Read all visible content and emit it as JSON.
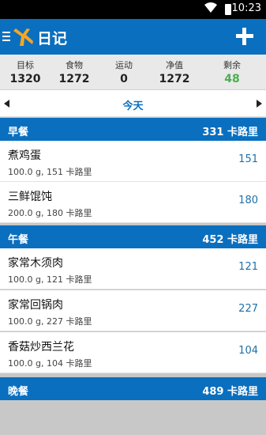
{
  "status": {
    "time": "10:23"
  },
  "header": {
    "title": "日记"
  },
  "summary": [
    {
      "label": "目标",
      "value": "1320"
    },
    {
      "label": "食物",
      "value": "1272"
    },
    {
      "label": "运动",
      "value": "0"
    },
    {
      "label": "净值",
      "value": "1272"
    },
    {
      "label": "剩余",
      "value": "48"
    }
  ],
  "date": {
    "label": "今天"
  },
  "meals": {
    "breakfast": {
      "name": "早餐",
      "calories": "331 卡路里"
    },
    "lunch": {
      "name": "午餐",
      "calories": "452 卡路里"
    },
    "dinner": {
      "name": "晚餐",
      "calories": "489 卡路里"
    }
  },
  "foods": [
    {
      "name": "煮鸡蛋",
      "detail": "100.0 g, 151 卡路里",
      "calories": "151"
    },
    {
      "name": "三鲜馄饨",
      "detail": "200.0 g, 180 卡路里",
      "calories": "180"
    },
    {
      "name": "家常木须肉",
      "detail": "100.0 g, 121 卡路里",
      "calories": "121"
    },
    {
      "name": "家常回锅肉",
      "detail": "100.0 g, 227 卡路里",
      "calories": "227"
    },
    {
      "name": "香菇炒西兰花",
      "detail": "100.0 g, 104 卡路里",
      "calories": "104"
    }
  ],
  "colors": {
    "brand": "#0a6fbf",
    "remaining": "#4caf50",
    "calorie_text": "#1f6fa8"
  },
  "icons": {
    "menu": "hamburger-icon",
    "logo": "running-figure-logo-icon",
    "add": "plus-icon",
    "prev": "triangle-left-icon",
    "next": "triangle-right-icon"
  }
}
